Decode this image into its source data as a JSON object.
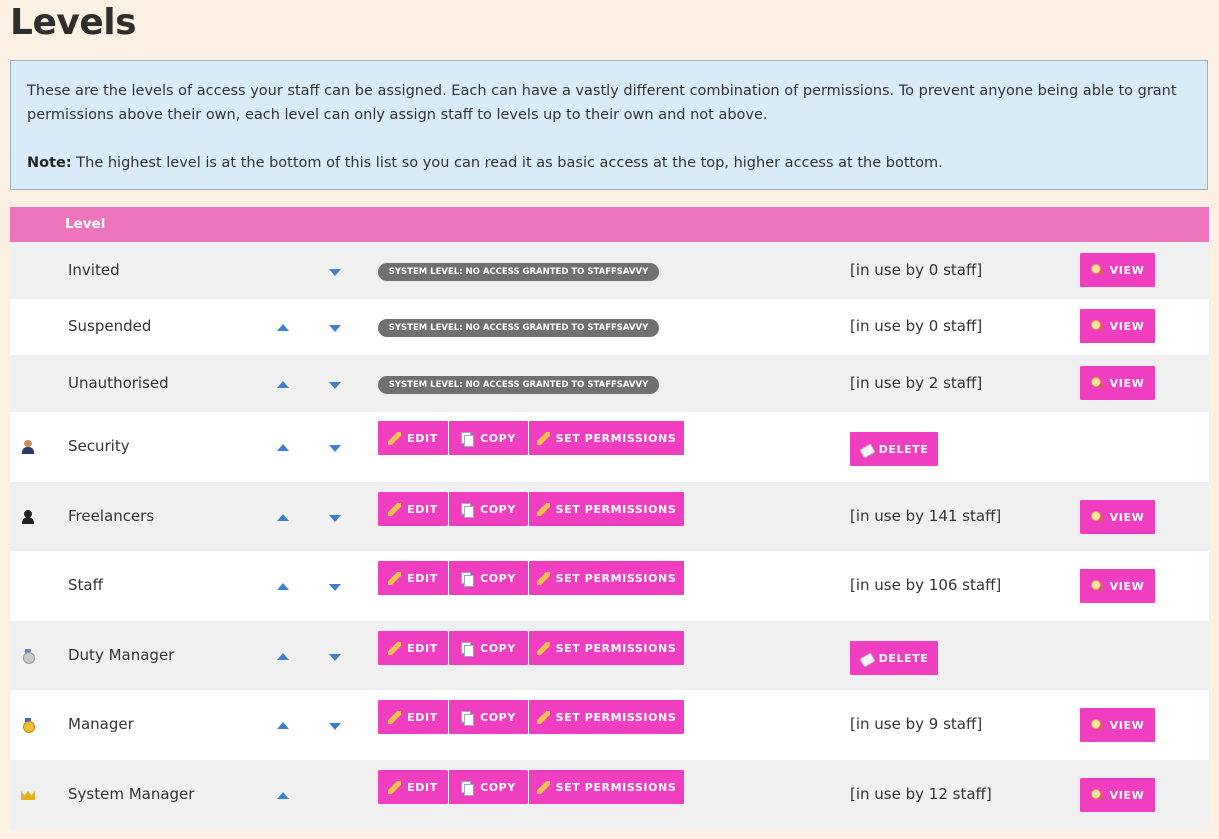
{
  "page": {
    "title": "Levels"
  },
  "info": {
    "text": "These are the levels of access your staff can be assigned. Each can have a vastly different combination of permissions. To prevent anyone being able to grant permissions above their own, each level can only assign staff to levels up to their own and not above.",
    "note_label": "Note:",
    "note_text": " The highest level is at the bottom of this list so you can read it as basic access at the top, higher access at the bottom."
  },
  "table": {
    "header": "Level",
    "system_pill": "SYSTEM LEVEL: NO ACCESS GRANTED TO STAFFSAVVY",
    "buttons": {
      "edit": "EDIT",
      "copy": "COPY",
      "permissions": "SET PERMISSIONS",
      "view": "VIEW",
      "delete": "DELETE"
    },
    "rows": [
      {
        "name": "Invited",
        "icon": "",
        "up": false,
        "down": true,
        "system": true,
        "usage": "[in use by 0 staff]",
        "action": "view"
      },
      {
        "name": "Suspended",
        "icon": "",
        "up": true,
        "down": true,
        "system": true,
        "usage": "[in use by 0 staff]",
        "action": "view"
      },
      {
        "name": "Unauthorised",
        "icon": "",
        "up": true,
        "down": true,
        "system": true,
        "usage": "[in use by 2 staff]",
        "action": "view"
      },
      {
        "name": "Security",
        "icon": "security-guard-icon",
        "up": true,
        "down": true,
        "system": false,
        "usage": "",
        "action": "delete"
      },
      {
        "name": "Freelancers",
        "icon": "person-silhouette-icon",
        "up": true,
        "down": true,
        "system": false,
        "usage": "[in use by 141 staff]",
        "action": "view"
      },
      {
        "name": "Staff",
        "icon": "",
        "up": true,
        "down": true,
        "system": false,
        "usage": "[in use by 106 staff]",
        "action": "view"
      },
      {
        "name": "Duty Manager",
        "icon": "silver-medal-icon",
        "up": true,
        "down": true,
        "system": false,
        "usage": "",
        "action": "delete"
      },
      {
        "name": "Manager",
        "icon": "gold-medal-icon",
        "up": true,
        "down": true,
        "system": false,
        "usage": "[in use by 9 staff]",
        "action": "view"
      },
      {
        "name": "System Manager",
        "icon": "crown-icon",
        "up": true,
        "down": false,
        "system": false,
        "usage": "[in use by 12 staff]",
        "action": "view"
      }
    ]
  },
  "colors": {
    "accent": "#f03ec0",
    "header": "#ee74be",
    "info_bg": "#d7ebf9",
    "page_bg": "#fbf0e2"
  }
}
